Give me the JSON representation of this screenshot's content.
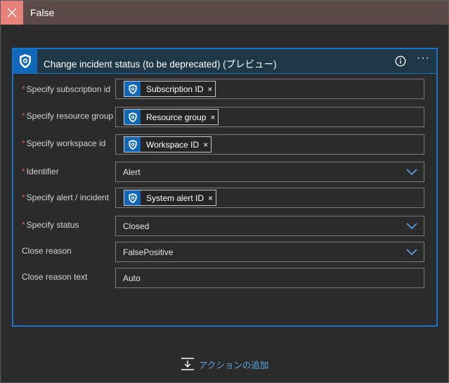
{
  "topbar": {
    "title": "False"
  },
  "card": {
    "title": "Change incident status (to be deprecated) (プレビュー)",
    "info_icon": "info-icon",
    "more_label": "···",
    "fields": [
      {
        "label": "Specify subscription id",
        "required": true,
        "token": "Subscription ID"
      },
      {
        "label": "Specify resource group",
        "required": true,
        "token": "Resource group"
      },
      {
        "label": "Specify workspace id",
        "required": true,
        "token": "Workspace ID"
      },
      {
        "label": "Identifier",
        "required": true,
        "value": "Alert",
        "dropdown": true
      },
      {
        "label": "Specify alert / incident",
        "required": true,
        "token": "System alert ID"
      },
      {
        "label": "Specify status",
        "required": true,
        "value": "Closed",
        "dropdown": true
      },
      {
        "label": "Close reason",
        "required": false,
        "value": "FalsePositive",
        "dropdown": true
      },
      {
        "label": "Close reason text",
        "required": false,
        "value": "Auto"
      }
    ]
  },
  "add_action": {
    "label": "アクションの追加"
  },
  "colors": {
    "accent": "#1a73c9",
    "link": "#5aa6e8",
    "required": "#e2554f",
    "false_header": "#5b4a47",
    "false_badge": "#e7817a"
  },
  "required_mark": "*",
  "token_close": "×"
}
